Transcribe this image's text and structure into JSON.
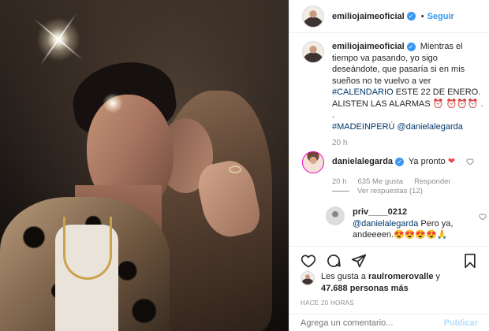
{
  "header": {
    "username": "emiliojaimeoficial",
    "separator": "•",
    "follow_label": "Seguir"
  },
  "caption": {
    "username": "emiliojaimeoficial",
    "text_1": "Mientras el tiempo va pasando, yo sigo deseándote, que pasaría si en mis sueños no te vuelvo a ver",
    "hashtag_1": "#CALENDARIO",
    "text_2": "ESTE 22 DE ENERO. ALISTEN LAS ALARMAS",
    "alarm_emojis": "⏰ ⏰⏰⏰ .",
    "dot_line": ".",
    "hashtag_2": "#MADEINPERÚ",
    "mention": "@danielalegarda",
    "time": "20 h"
  },
  "comment_1": {
    "username": "danielalegarda",
    "text": "Ya pronto",
    "emoji": "❤",
    "time": "20 h",
    "likes": "635 Me gusta",
    "reply_label": "Responder",
    "view_replies": "Ver respuestas (12)"
  },
  "comment_2": {
    "username": "priv____0212",
    "mention": "@danielalegarda",
    "text": "Pero ya, andeeeen.",
    "emojis": "😍😍😍😍🙏"
  },
  "likes": {
    "prefix": "Les gusta a",
    "user": "raulromerovalle",
    "connector": "y",
    "others": "47.688 personas más"
  },
  "posted_ago": "HACE 20 HORAS",
  "add_comment": {
    "placeholder": "Agrega un comentario...",
    "publish_label": "Publicar"
  },
  "icons": {
    "more": "more-icon",
    "heart": "heart-icon",
    "comment": "comment-icon",
    "share": "share-icon",
    "save": "bookmark-icon"
  },
  "colors": {
    "accent": "#3897f0",
    "link": "#00376b",
    "secondary_text": "#8e8e8e",
    "heart": "#ed4956"
  }
}
